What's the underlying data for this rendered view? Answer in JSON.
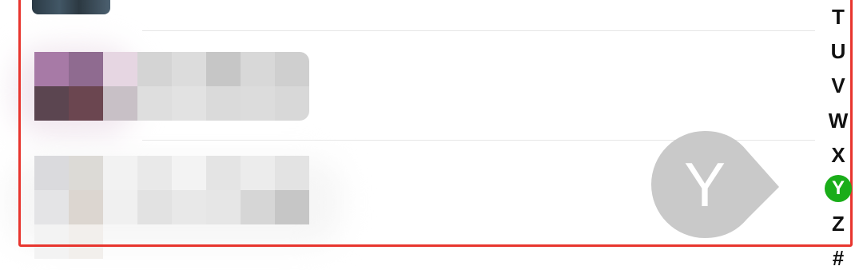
{
  "index_bar": {
    "letters": [
      "T",
      "U",
      "V",
      "W",
      "X",
      "Y",
      "Z",
      "#"
    ],
    "active": "Y",
    "active_color": "#1aad19"
  },
  "index_popup": {
    "letter": "Y",
    "color": "#c9c9c9"
  },
  "highlight_color": "#e8352e",
  "contacts": [
    {
      "name": "",
      "note": "avatar-partially-visible"
    },
    {
      "name": "",
      "note": "pixelated-obscured"
    },
    {
      "name": "",
      "note": "pixelated-obscured"
    }
  ]
}
